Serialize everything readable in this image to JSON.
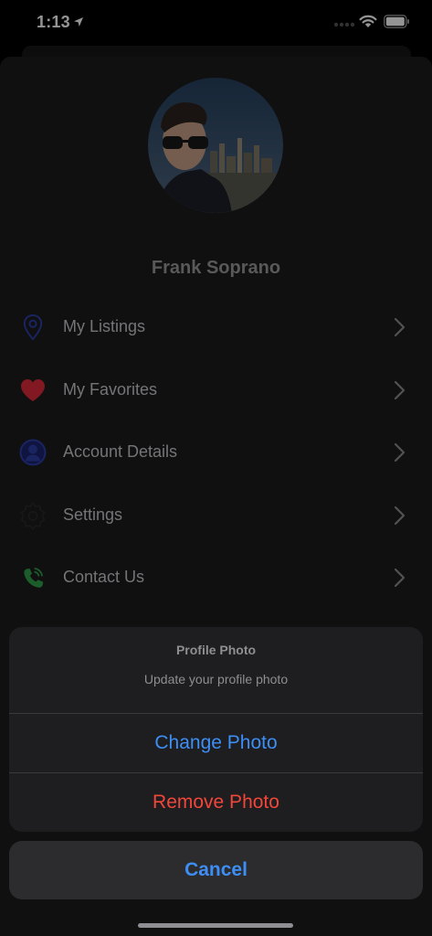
{
  "status_bar": {
    "time": "1:13"
  },
  "profile": {
    "name": "Frank Soprano"
  },
  "menu": [
    {
      "label": "My Listings",
      "icon": "location-pin-icon"
    },
    {
      "label": "My Favorites",
      "icon": "heart-icon"
    },
    {
      "label": "Account Details",
      "icon": "user-circle-icon"
    },
    {
      "label": "Settings",
      "icon": "gear-icon"
    },
    {
      "label": "Contact Us",
      "icon": "phone-icon"
    }
  ],
  "action_sheet": {
    "title": "Profile Photo",
    "message": "Update your profile photo",
    "change_label": "Change Photo",
    "remove_label": "Remove Photo",
    "cancel_label": "Cancel"
  },
  "colors": {
    "accent_blue": "#3d8ef5",
    "destructive_red": "#f2463a",
    "heart_red": "#e02a3c",
    "icon_blue": "#2c3ea8",
    "phone_green": "#2fa24a"
  }
}
